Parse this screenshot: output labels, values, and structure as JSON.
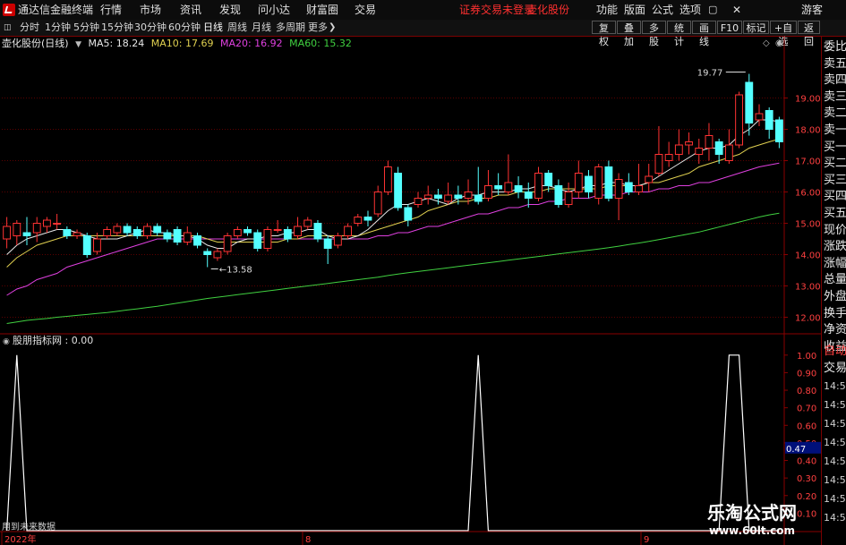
{
  "title_bar": {
    "app_name": "通达信金融终端",
    "menu": [
      "行情",
      "市场",
      "资讯",
      "发现",
      "问小达",
      "财富圈",
      "交易"
    ],
    "login_notice": "证券交易未登录",
    "stock_link": "壶化股份",
    "right_menu": [
      "功能",
      "版面",
      "公式",
      "选项"
    ],
    "user": "游客"
  },
  "period_toolbar": {
    "periods": [
      "分时",
      "1分钟",
      "5分钟",
      "15分钟",
      "30分钟",
      "60分钟",
      "日线",
      "周线",
      "月线",
      "多周期",
      "更多"
    ],
    "active": "日线",
    "right_buttons": [
      "复权",
      "叠加",
      "多股",
      "统计",
      "画线",
      "F10",
      "标记",
      "+自选",
      "返回"
    ]
  },
  "main_chart": {
    "stock_label": "壶化股份(日线)",
    "ma": [
      {
        "label": "MA5: 18.24",
        "color": "#e8e8e8"
      },
      {
        "label": "MA10: 17.69",
        "color": "#e0d050"
      },
      {
        "label": "MA20: 16.92",
        "color": "#e040e0"
      },
      {
        "label": "MA60: 15.32",
        "color": "#40d040"
      }
    ],
    "high_label": "19.77",
    "low_label": "13.58",
    "up_color": "#ff3333",
    "down_color": "#54ffff"
  },
  "indicator": {
    "label": "股朋指标网 : 0.00",
    "bottom_note": "用到未来数据",
    "current_value": "0.47",
    "line_color": "#ffffff"
  },
  "x_axis": {
    "labels": [
      "2022年",
      "8",
      "9"
    ]
  },
  "right_panel": {
    "items": [
      "委比",
      "卖五",
      "卖四",
      "卖三",
      "卖二",
      "卖一",
      "买一",
      "买二",
      "买三",
      "买四",
      "买五",
      "现价",
      "涨跌",
      "涨幅",
      "总量",
      "外盘",
      "换手",
      "净资",
      "收益"
    ],
    "trade_items": [
      "自动",
      "交易"
    ],
    "times": [
      "14:55",
      "14:56",
      "14:56",
      "14:56",
      "14:56",
      "14:56",
      "14:56",
      "14:56"
    ]
  },
  "watermark": {
    "main": "乐淘公式网",
    "url": "www.60lt.com"
  },
  "chart_data": {
    "type": "candlestick",
    "price_ylim": [
      11.5,
      20.5
    ],
    "price_ticks": [
      "19.00",
      "18.00",
      "17.00",
      "16.00",
      "15.00",
      "14.00",
      "13.00",
      "12.00"
    ],
    "candles": [
      [
        14.5,
        14.9,
        14.2,
        15.2
      ],
      [
        14.6,
        15.0,
        14.3,
        15.1
      ],
      [
        14.7,
        14.6,
        14.3,
        15.2
      ],
      [
        14.7,
        15.0,
        14.4,
        15.2
      ],
      [
        14.9,
        15.1,
        14.7,
        15.2
      ],
      [
        15.0,
        15.0,
        14.8,
        15.3
      ],
      [
        14.8,
        14.6,
        14.5,
        14.9
      ],
      [
        14.6,
        14.7,
        14.5,
        14.8
      ],
      [
        14.6,
        14.0,
        13.9,
        14.7
      ],
      [
        14.1,
        14.5,
        14.0,
        14.7
      ],
      [
        14.6,
        14.8,
        14.5,
        14.9
      ],
      [
        14.7,
        14.9,
        14.6,
        15.0
      ],
      [
        14.9,
        14.7,
        14.6,
        15.0
      ],
      [
        14.8,
        14.6,
        14.5,
        14.9
      ],
      [
        14.6,
        14.9,
        14.5,
        15.0
      ],
      [
        14.9,
        14.7,
        14.6,
        15.0
      ],
      [
        14.7,
        14.5,
        14.4,
        14.8
      ],
      [
        14.8,
        14.4,
        14.3,
        14.9
      ],
      [
        14.4,
        14.7,
        14.3,
        14.9
      ],
      [
        14.6,
        14.3,
        14.2,
        14.7
      ],
      [
        14.1,
        14.0,
        13.6,
        14.2
      ],
      [
        13.9,
        14.1,
        13.8,
        14.2
      ],
      [
        14.1,
        14.6,
        14.0,
        14.7
      ],
      [
        14.6,
        14.8,
        14.5,
        14.9
      ],
      [
        14.8,
        14.7,
        14.6,
        14.9
      ],
      [
        14.7,
        14.2,
        14.1,
        14.8
      ],
      [
        14.2,
        14.8,
        14.1,
        14.9
      ],
      [
        14.8,
        14.8,
        14.7,
        15.1
      ],
      [
        14.8,
        14.5,
        14.4,
        14.9
      ],
      [
        14.6,
        14.9,
        14.5,
        15.2
      ],
      [
        14.9,
        15.1,
        14.8,
        15.2
      ],
      [
        15.0,
        14.5,
        14.4,
        15.1
      ],
      [
        14.5,
        14.2,
        13.7,
        14.6
      ],
      [
        14.3,
        14.6,
        14.2,
        14.7
      ],
      [
        14.6,
        14.9,
        14.5,
        15.0
      ],
      [
        15.0,
        15.2,
        14.9,
        15.3
      ],
      [
        15.2,
        15.1,
        14.9,
        15.4
      ],
      [
        15.3,
        16.0,
        15.2,
        16.2
      ],
      [
        16.0,
        16.8,
        15.9,
        17.0
      ],
      [
        16.6,
        15.5,
        15.4,
        16.8
      ],
      [
        15.5,
        15.1,
        14.9,
        15.6
      ],
      [
        15.6,
        15.8,
        15.5,
        16.0
      ],
      [
        15.8,
        15.9,
        15.6,
        16.2
      ],
      [
        15.9,
        15.8,
        15.6,
        16.1
      ],
      [
        15.7,
        15.9,
        15.6,
        16.3
      ],
      [
        15.9,
        15.8,
        15.6,
        16.2
      ],
      [
        15.8,
        16.0,
        15.6,
        16.4
      ],
      [
        15.9,
        15.7,
        15.6,
        16.8
      ],
      [
        15.8,
        16.2,
        15.7,
        16.7
      ],
      [
        16.2,
        16.1,
        15.9,
        16.6
      ],
      [
        16.0,
        16.3,
        15.9,
        17.2
      ],
      [
        16.2,
        16.0,
        15.8,
        16.5
      ],
      [
        16.0,
        15.8,
        15.5,
        16.3
      ],
      [
        15.8,
        16.6,
        15.7,
        16.8
      ],
      [
        16.6,
        16.2,
        16.0,
        16.7
      ],
      [
        16.2,
        15.6,
        15.5,
        16.4
      ],
      [
        15.6,
        16.0,
        15.5,
        16.3
      ],
      [
        16.0,
        16.6,
        15.8,
        17.0
      ],
      [
        16.5,
        16.0,
        15.8,
        16.7
      ],
      [
        15.8,
        16.8,
        15.6,
        16.9
      ],
      [
        16.8,
        15.8,
        15.7,
        17.0
      ],
      [
        15.8,
        16.4,
        15.1,
        16.6
      ],
      [
        16.3,
        16.0,
        15.9,
        16.6
      ],
      [
        16.0,
        16.2,
        15.9,
        16.9
      ],
      [
        16.3,
        16.5,
        16.0,
        16.9
      ],
      [
        16.6,
        17.2,
        16.5,
        18.1
      ],
      [
        17.0,
        17.2,
        16.8,
        17.6
      ],
      [
        17.2,
        17.5,
        17.0,
        18.0
      ],
      [
        17.5,
        17.6,
        17.2,
        17.9
      ],
      [
        17.2,
        17.4,
        16.9,
        17.7
      ],
      [
        17.4,
        17.8,
        17.0,
        18.2
      ],
      [
        17.6,
        17.2,
        16.9,
        17.7
      ],
      [
        17.0,
        17.5,
        16.9,
        18.0
      ],
      [
        17.5,
        19.1,
        17.4,
        19.2
      ],
      [
        19.5,
        18.2,
        17.8,
        19.77
      ],
      [
        18.3,
        18.5,
        18.1,
        18.8
      ],
      [
        18.6,
        18.0,
        17.7,
        18.7
      ],
      [
        18.3,
        17.6,
        17.4,
        18.4
      ]
    ],
    "ma5": [
      14.0,
      14.3,
      14.5,
      14.6,
      14.7,
      14.8,
      14.8,
      14.7,
      14.6,
      14.5,
      14.5,
      14.5,
      14.6,
      14.7,
      14.8,
      14.7,
      14.7,
      14.6,
      14.6,
      14.5,
      14.3,
      14.2,
      14.2,
      14.4,
      14.5,
      14.5,
      14.6,
      14.6,
      14.7,
      14.7,
      14.8,
      14.8,
      14.6,
      14.5,
      14.5,
      14.6,
      14.8,
      15.1,
      15.4,
      15.6,
      15.6,
      15.7,
      15.8,
      15.7,
      15.6,
      15.8,
      15.9,
      15.9,
      16.0,
      16.0,
      16.0,
      16.1,
      16.1,
      16.2,
      16.2,
      16.1,
      16.0,
      16.1,
      16.2,
      16.2,
      16.3,
      16.3,
      16.2,
      16.2,
      16.3,
      16.5,
      16.7,
      16.9,
      17.1,
      17.3,
      17.4,
      17.4,
      17.5,
      17.8,
      18.0,
      18.3,
      18.3,
      18.24
    ],
    "ma10": [
      13.6,
      13.9,
      14.1,
      14.3,
      14.4,
      14.5,
      14.6,
      14.6,
      14.6,
      14.6,
      14.6,
      14.6,
      14.6,
      14.6,
      14.6,
      14.6,
      14.6,
      14.6,
      14.6,
      14.6,
      14.5,
      14.4,
      14.4,
      14.4,
      14.4,
      14.4,
      14.4,
      14.4,
      14.5,
      14.5,
      14.6,
      14.6,
      14.6,
      14.6,
      14.6,
      14.6,
      14.7,
      14.8,
      14.9,
      15.0,
      15.1,
      15.2,
      15.4,
      15.5,
      15.6,
      15.7,
      15.7,
      15.8,
      15.8,
      15.9,
      15.9,
      16.0,
      16.0,
      16.0,
      16.1,
      16.1,
      16.1,
      16.1,
      16.1,
      16.1,
      16.2,
      16.2,
      16.2,
      16.2,
      16.3,
      16.3,
      16.4,
      16.5,
      16.6,
      16.8,
      16.9,
      17.0,
      17.1,
      17.2,
      17.4,
      17.5,
      17.6,
      17.69
    ],
    "ma20": [
      12.7,
      12.9,
      13.0,
      13.2,
      13.3,
      13.4,
      13.6,
      13.7,
      13.8,
      13.9,
      14.0,
      14.1,
      14.2,
      14.3,
      14.4,
      14.5,
      14.5,
      14.5,
      14.5,
      14.5,
      14.5,
      14.5,
      14.5,
      14.5,
      14.5,
      14.5,
      14.5,
      14.5,
      14.5,
      14.5,
      14.5,
      14.5,
      14.5,
      14.5,
      14.5,
      14.5,
      14.5,
      14.6,
      14.6,
      14.7,
      14.7,
      14.8,
      14.9,
      14.9,
      15.0,
      15.1,
      15.2,
      15.3,
      15.3,
      15.4,
      15.5,
      15.5,
      15.6,
      15.6,
      15.7,
      15.7,
      15.8,
      15.8,
      15.8,
      15.9,
      15.9,
      15.9,
      16.0,
      16.0,
      16.0,
      16.1,
      16.1,
      16.2,
      16.2,
      16.3,
      16.3,
      16.4,
      16.5,
      16.6,
      16.7,
      16.8,
      16.86,
      16.92
    ],
    "ma60": [
      11.8,
      11.85,
      11.9,
      11.93,
      11.96,
      12.0,
      12.03,
      12.06,
      12.09,
      12.12,
      12.15,
      12.19,
      12.23,
      12.27,
      12.31,
      12.35,
      12.4,
      12.45,
      12.5,
      12.55,
      12.6,
      12.64,
      12.68,
      12.72,
      12.76,
      12.8,
      12.84,
      12.88,
      12.92,
      12.96,
      13.0,
      13.04,
      13.08,
      13.12,
      13.16,
      13.2,
      13.24,
      13.28,
      13.33,
      13.38,
      13.42,
      13.46,
      13.5,
      13.54,
      13.58,
      13.62,
      13.66,
      13.7,
      13.74,
      13.78,
      13.82,
      13.86,
      13.9,
      13.94,
      13.98,
      14.02,
      14.06,
      14.1,
      14.14,
      14.18,
      14.22,
      14.27,
      14.32,
      14.37,
      14.42,
      14.48,
      14.54,
      14.6,
      14.66,
      14.72,
      14.8,
      14.88,
      14.96,
      15.04,
      15.12,
      15.2,
      15.27,
      15.32
    ],
    "indicator_ylim": [
      0,
      1.05
    ],
    "indicator_ticks": [
      "1.00",
      "0.90",
      "0.80",
      "0.70",
      "0.60",
      "0.50",
      "0.40",
      "0.30",
      "0.20",
      "0.10"
    ],
    "indicator": [
      0,
      1,
      0,
      0,
      0,
      0,
      0,
      0,
      0,
      0,
      0,
      0,
      0,
      0,
      0,
      0,
      0,
      0,
      0,
      0,
      0,
      0,
      0,
      0,
      0,
      0,
      0,
      0,
      0,
      0,
      0,
      0,
      0,
      0,
      0,
      0,
      0,
      0,
      0,
      0,
      0,
      0,
      0,
      0,
      0,
      0,
      0,
      1,
      0,
      0,
      0,
      0,
      0,
      0,
      0,
      0,
      0,
      0,
      0,
      0,
      0,
      0,
      0,
      0,
      0,
      0,
      0,
      0,
      0,
      0,
      0,
      0,
      1,
      1,
      0,
      0,
      0,
      0
    ]
  }
}
